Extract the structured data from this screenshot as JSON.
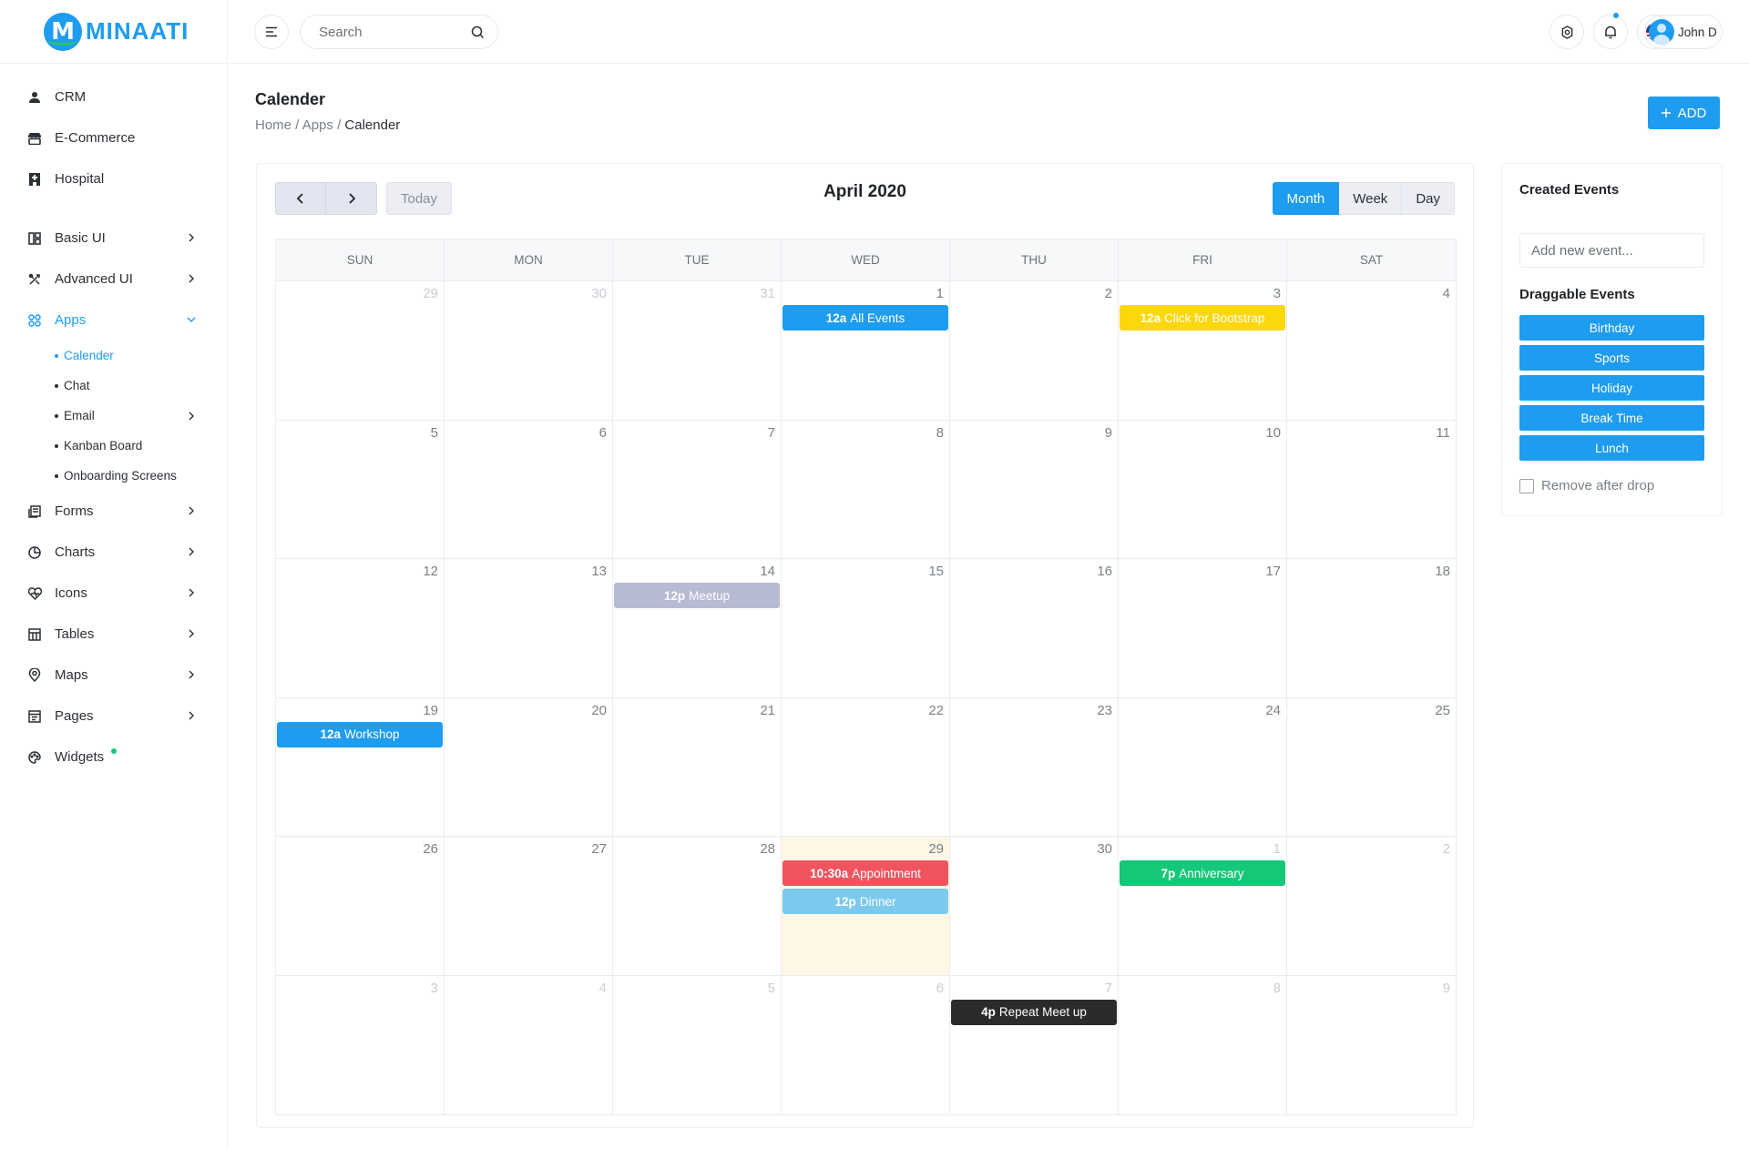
{
  "brand": {
    "mark": "M",
    "name": "MINAATI"
  },
  "colors": {
    "accent": "#1e9cf0",
    "yellow": "#fcd70a",
    "red": "#f0555f",
    "light_blue": "#7cc9ee",
    "green": "#14c877",
    "gray": "#b6bad2",
    "dark": "#2b2b2b"
  },
  "sidebar": {
    "items": [
      {
        "label": "CRM",
        "icon": "user-icon"
      },
      {
        "label": "E-Commerce",
        "icon": "store-icon"
      },
      {
        "label": "Hospital",
        "icon": "hospital-icon"
      },
      {
        "label": "Basic UI",
        "icon": "layout-icon"
      },
      {
        "label": "Advanced UI",
        "icon": "tools-icon"
      },
      {
        "label": "Apps",
        "icon": "grid-icon"
      },
      {
        "label": "Forms",
        "icon": "forms-icon"
      },
      {
        "label": "Charts",
        "icon": "pie-chart-icon"
      },
      {
        "label": "Icons",
        "icon": "heart-icon"
      },
      {
        "label": "Tables",
        "icon": "table-icon"
      },
      {
        "label": "Maps",
        "icon": "map-pin-icon"
      },
      {
        "label": "Pages",
        "icon": "pages-icon"
      },
      {
        "label": "Widgets",
        "icon": "palette-icon"
      }
    ],
    "apps_sub": [
      "Calender",
      "Chat",
      "Email",
      "Kanban Board",
      "Onboarding Screens"
    ]
  },
  "topbar": {
    "search_placeholder": "Search",
    "user_name": "John D"
  },
  "page": {
    "title": "Calender",
    "breadcrumb": {
      "home": "Home",
      "sep1": " / ",
      "apps": "Apps",
      "sep2": " / ",
      "current": "Calender"
    },
    "add_label": "ADD"
  },
  "calendar": {
    "title": "April 2020",
    "today_label": "Today",
    "views": [
      "Month",
      "Week",
      "Day"
    ],
    "active_view": "Month",
    "weekdays": [
      "SUN",
      "MON",
      "TUE",
      "WED",
      "THU",
      "FRI",
      "SAT"
    ],
    "weeks": [
      [
        {
          "d": "29",
          "o": true
        },
        {
          "d": "30",
          "o": true
        },
        {
          "d": "31",
          "o": true
        },
        {
          "d": "1"
        },
        {
          "d": "2"
        },
        {
          "d": "3"
        },
        {
          "d": "4"
        }
      ],
      [
        {
          "d": "5"
        },
        {
          "d": "6"
        },
        {
          "d": "7"
        },
        {
          "d": "8"
        },
        {
          "d": "9"
        },
        {
          "d": "10"
        },
        {
          "d": "11"
        }
      ],
      [
        {
          "d": "12"
        },
        {
          "d": "13"
        },
        {
          "d": "14"
        },
        {
          "d": "15"
        },
        {
          "d": "16"
        },
        {
          "d": "17"
        },
        {
          "d": "18"
        }
      ],
      [
        {
          "d": "19"
        },
        {
          "d": "20"
        },
        {
          "d": "21"
        },
        {
          "d": "22"
        },
        {
          "d": "23"
        },
        {
          "d": "24"
        },
        {
          "d": "25"
        }
      ],
      [
        {
          "d": "26"
        },
        {
          "d": "27"
        },
        {
          "d": "28"
        },
        {
          "d": "29",
          "today": true
        },
        {
          "d": "30"
        },
        {
          "d": "1",
          "o": true
        },
        {
          "d": "2",
          "o": true
        }
      ],
      [
        {
          "d": "3",
          "o": true
        },
        {
          "d": "4",
          "o": true
        },
        {
          "d": "5",
          "o": true
        },
        {
          "d": "6",
          "o": true
        },
        {
          "d": "7",
          "o": true
        },
        {
          "d": "8",
          "o": true
        },
        {
          "d": "9",
          "o": true
        }
      ]
    ],
    "events": [
      {
        "week": 0,
        "day": 3,
        "slot": 0,
        "time": "12a",
        "title": "All Events",
        "color": "#1e9cf0"
      },
      {
        "week": 0,
        "day": 5,
        "slot": 0,
        "time": "12a",
        "title": "Click for Bootstrap",
        "color": "#fcd70a"
      },
      {
        "week": 2,
        "day": 2,
        "slot": 0,
        "time": "12p",
        "title": "Meetup",
        "color": "#b6bad2"
      },
      {
        "week": 3,
        "day": 0,
        "slot": 0,
        "time": "12a",
        "title": "Workshop",
        "color": "#1e9cf0"
      },
      {
        "week": 4,
        "day": 3,
        "slot": 0,
        "time": "10:30a",
        "title": "Appointment",
        "color": "#f0555f"
      },
      {
        "week": 4,
        "day": 3,
        "slot": 1,
        "time": "12p",
        "title": "Dinner",
        "color": "#7cc9ee"
      },
      {
        "week": 4,
        "day": 5,
        "slot": 0,
        "time": "7p",
        "title": "Anniversary",
        "color": "#14c877"
      },
      {
        "week": 5,
        "day": 4,
        "slot": 0,
        "time": "4p",
        "title": "Repeat Meet up",
        "color": "#2b2b2b"
      }
    ]
  },
  "side_panel": {
    "created_title": "Created Events",
    "new_event_placeholder": "Add new event...",
    "draggable_title": "Draggable Events",
    "draggable": [
      "Birthday",
      "Sports",
      "Holiday",
      "Break Time",
      "Lunch"
    ],
    "remove_label": "Remove after drop"
  }
}
